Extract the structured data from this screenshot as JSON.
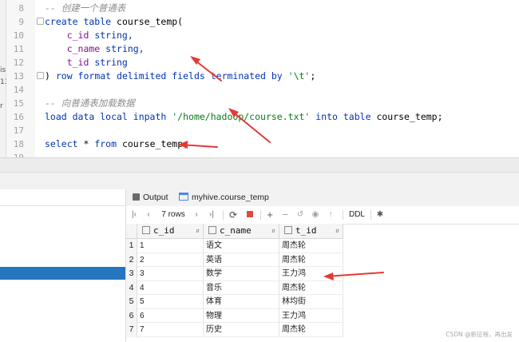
{
  "editor": {
    "lines": [
      {
        "n": "8",
        "tokens": [
          {
            "t": "-- 创建一个普通表",
            "c": "cm"
          }
        ]
      },
      {
        "n": "9",
        "tokens": [
          {
            "t": "create table ",
            "c": "kw"
          },
          {
            "t": "course_temp(",
            "c": ""
          }
        ]
      },
      {
        "n": "10",
        "tokens": [
          {
            "t": "    c_id ",
            "c": "id"
          },
          {
            "t": "string,",
            "c": "kw"
          }
        ]
      },
      {
        "n": "11",
        "tokens": [
          {
            "t": "    c_name ",
            "c": "id"
          },
          {
            "t": "string,",
            "c": "kw"
          }
        ]
      },
      {
        "n": "12",
        "tokens": [
          {
            "t": "    t_id ",
            "c": "id"
          },
          {
            "t": "string",
            "c": "kw"
          }
        ]
      },
      {
        "n": "13",
        "tokens": [
          {
            "t": ") ",
            "c": ""
          },
          {
            "t": "row format delimited fields terminated by ",
            "c": "kw"
          },
          {
            "t": "'\\t'",
            "c": "str"
          },
          {
            "t": ";",
            "c": ""
          }
        ]
      },
      {
        "n": "14",
        "tokens": []
      },
      {
        "n": "15",
        "tokens": [
          {
            "t": "-- 向普通表加载数据",
            "c": "cm"
          }
        ]
      },
      {
        "n": "16",
        "tokens": [
          {
            "t": "load data local inpath ",
            "c": "kw"
          },
          {
            "t": "'/home/hadoop/course.txt'",
            "c": "str"
          },
          {
            "t": " into table ",
            "c": "kw"
          },
          {
            "t": "course_temp;",
            "c": ""
          }
        ]
      },
      {
        "n": "17",
        "tokens": []
      },
      {
        "n": "18",
        "tokens": [
          {
            "t": "select ",
            "c": "kw"
          },
          {
            "t": "* ",
            "c": ""
          },
          {
            "t": "from ",
            "c": "kw"
          },
          {
            "t": "course_temp;",
            "c": ""
          }
        ]
      },
      {
        "n": "19",
        "tokens": []
      }
    ],
    "left_strip": [
      "is",
      "13",
      "r"
    ]
  },
  "tabs": [
    {
      "label": "Output",
      "icon": "output-icon"
    },
    {
      "label": "myhive.course_temp",
      "icon": "table-icon",
      "close": "×"
    }
  ],
  "toolbar": {
    "rows_label": "7 rows",
    "ddl_label": "DDL"
  },
  "grid": {
    "columns": [
      "c_id",
      "c_name",
      "t_id"
    ],
    "rows": [
      [
        "1",
        "1",
        "语文",
        "周杰轮"
      ],
      [
        "2",
        "2",
        "英语",
        "周杰轮"
      ],
      [
        "3",
        "3",
        "数学",
        "王力鸿"
      ],
      [
        "4",
        "4",
        "音乐",
        "周杰轮"
      ],
      [
        "5",
        "5",
        "体育",
        "林均街"
      ],
      [
        "6",
        "6",
        "物理",
        "王力鸿"
      ],
      [
        "7",
        "7",
        "历史",
        "周杰轮"
      ]
    ]
  },
  "watermark": "CSDN @新征程，再出发",
  "colors": {
    "keyword": "#0033b3",
    "string": "#067d17",
    "identifier": "#871094",
    "comment": "#8c8c8c",
    "arrow": "#e53935",
    "selection": "#2675bf"
  }
}
